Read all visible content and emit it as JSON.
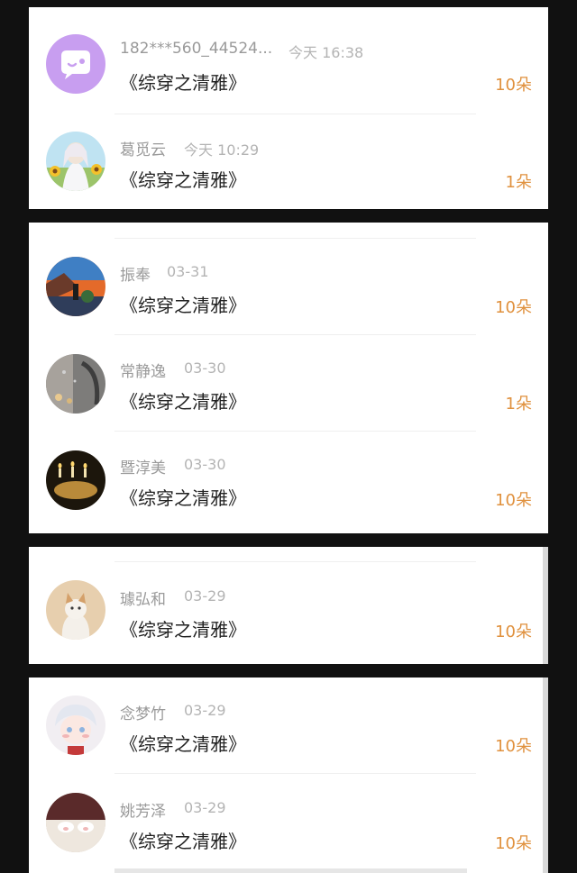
{
  "gifts": [
    {
      "name": "182***560_44524...",
      "time": "今天 16:38",
      "book": "《综穿之清雅》",
      "amount": "10朵",
      "avatar_icon": "chat-bubble-avatar-icon"
    },
    {
      "name": "葛觅云",
      "time": "今天 10:29",
      "book": "《综穿之清雅》",
      "amount": "1朵",
      "avatar_icon": "anime-girl-sunflower-avatar"
    },
    {
      "name": "振奉",
      "time": "03-31",
      "book": "《综穿之清雅》",
      "amount": "10朵",
      "avatar_icon": "sunset-photo-avatar"
    },
    {
      "name": "常静逸",
      "time": "03-30",
      "book": "《综穿之清雅》",
      "amount": "1朵",
      "avatar_icon": "rainy-window-avatar"
    },
    {
      "name": "暨淳美",
      "time": "03-30",
      "book": "《综穿之清雅》",
      "amount": "10朵",
      "avatar_icon": "candles-avatar"
    },
    {
      "name": "璩弘和",
      "time": "03-29",
      "book": "《综穿之清雅》",
      "amount": "10朵",
      "avatar_icon": "cat-avatar"
    },
    {
      "name": "念梦竹",
      "time": "03-29",
      "book": "《综穿之清雅》",
      "amount": "10朵",
      "avatar_icon": "anime-boy-avatar"
    },
    {
      "name": "姚芳泽",
      "time": "03-29",
      "book": "《综穿之清雅》",
      "amount": "10朵",
      "avatar_icon": "cat-paws-avatar"
    }
  ],
  "colors": {
    "amount": "#e0913e",
    "chat_avatar": "#c89ef0",
    "background": "#111111"
  }
}
